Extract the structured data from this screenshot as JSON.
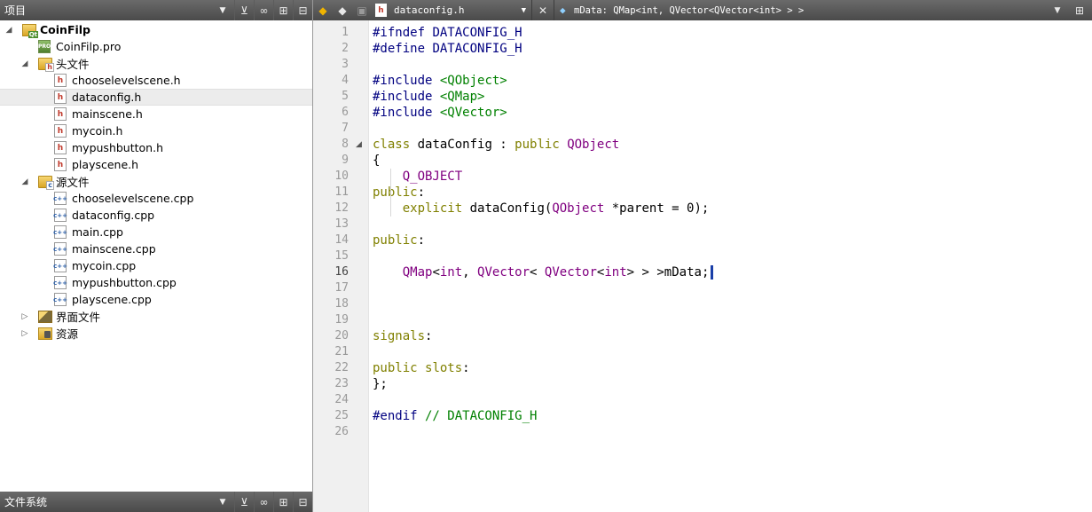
{
  "project_panel": {
    "title": "项目",
    "tree": [
      {
        "label": "CoinFilp",
        "level": 0,
        "icon": "project-folder-icon",
        "expanded": true,
        "bold": true
      },
      {
        "label": "CoinFilp.pro",
        "level": 1,
        "icon": "pro-file-icon"
      },
      {
        "label": "头文件",
        "level": 1,
        "icon": "header-folder-icon",
        "expanded": true
      },
      {
        "label": "chooselevelscene.h",
        "level": 2,
        "icon": "header-file-icon"
      },
      {
        "label": "dataconfig.h",
        "level": 2,
        "icon": "header-file-icon",
        "selected": true
      },
      {
        "label": "mainscene.h",
        "level": 2,
        "icon": "header-file-icon"
      },
      {
        "label": "mycoin.h",
        "level": 2,
        "icon": "header-file-icon"
      },
      {
        "label": "mypushbutton.h",
        "level": 2,
        "icon": "header-file-icon"
      },
      {
        "label": "playscene.h",
        "level": 2,
        "icon": "header-file-icon"
      },
      {
        "label": "源文件",
        "level": 1,
        "icon": "source-folder-icon",
        "expanded": true
      },
      {
        "label": "chooselevelscene.cpp",
        "level": 2,
        "icon": "cpp-file-icon"
      },
      {
        "label": "dataconfig.cpp",
        "level": 2,
        "icon": "cpp-file-icon"
      },
      {
        "label": "main.cpp",
        "level": 2,
        "icon": "cpp-file-icon"
      },
      {
        "label": "mainscene.cpp",
        "level": 2,
        "icon": "cpp-file-icon"
      },
      {
        "label": "mycoin.cpp",
        "level": 2,
        "icon": "cpp-file-icon"
      },
      {
        "label": "mypushbutton.cpp",
        "level": 2,
        "icon": "cpp-file-icon"
      },
      {
        "label": "playscene.cpp",
        "level": 2,
        "icon": "cpp-file-icon"
      },
      {
        "label": "界面文件",
        "level": 1,
        "icon": "forms-folder-icon",
        "expanded": false
      },
      {
        "label": "资源",
        "level": 1,
        "icon": "resources-folder-icon",
        "expanded": false
      }
    ]
  },
  "filesystem_panel": {
    "title": "文件系统"
  },
  "editor": {
    "file_name": "dataconfig.h",
    "symbol": "mData: QMap<int, QVector<QVector<int> > >",
    "current_line": 16,
    "lines": [
      "#ifndef DATACONFIG_H",
      "#define DATACONFIG_H",
      "",
      "#include <QObject>",
      "#include <QMap>",
      "#include <QVector>",
      "",
      "class dataConfig : public QObject",
      "{",
      "    Q_OBJECT",
      "public:",
      "    explicit dataConfig(QObject *parent = 0);",
      "",
      "public:",
      "",
      "    QMap<int, QVector< QVector<int> > >mData;",
      "",
      "",
      "",
      "signals:",
      "",
      "public slots:",
      "};",
      "",
      "#endif // DATACONFIG_H",
      ""
    ]
  },
  "colors": {
    "toolbar_bg": "#5a5a5a",
    "preprocessor": "#000080",
    "string": "#008000",
    "keyword": "#808000",
    "type": "#800080",
    "gutter_bg": "#f0f0f0"
  }
}
